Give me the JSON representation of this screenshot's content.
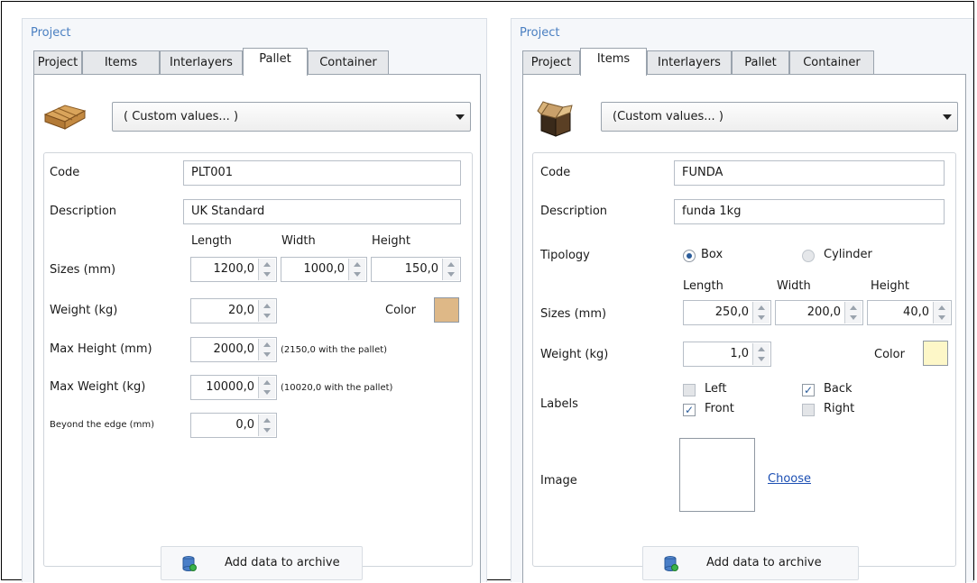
{
  "left_panel": {
    "title": "Project",
    "tabs": [
      "Project",
      "Items",
      "Interlayers",
      "Pallet",
      "Container"
    ],
    "active_tab": "Pallet",
    "icon": "pallet-icon",
    "preset": "( Custom values... )",
    "fields": {
      "code_label": "Code",
      "code": "PLT001",
      "description_label": "Description",
      "description": "UK Standard",
      "length_header": "Length",
      "width_header": "Width",
      "height_header": "Height",
      "sizes_label": "Sizes (mm)",
      "length": "1200,0",
      "width": "1000,0",
      "height": "150,0",
      "weight_label": "Weight (kg)",
      "weight": "20,0",
      "color_label": "Color",
      "color": "#deb887",
      "max_height_label": "Max Height (mm)",
      "max_height": "2000,0",
      "max_height_note": "(2150,0 with the pallet)",
      "max_weight_label": "Max Weight (kg)",
      "max_weight": "10000,0",
      "max_weight_note": "(10020,0 with the pallet)",
      "edge_label": "Beyond the edge (mm)",
      "edge": "0,0"
    },
    "add_button": "Add data to archive"
  },
  "right_panel": {
    "title": "Project",
    "tabs": [
      "Project",
      "Items",
      "Interlayers",
      "Pallet",
      "Container"
    ],
    "active_tab": "Items",
    "icon": "box-icon",
    "preset": "(Custom values... )",
    "fields": {
      "code_label": "Code",
      "code": "FUNDA",
      "description_label": "Description",
      "description": "funda 1kg",
      "tipology_label": "Tipology",
      "box_label": "Box",
      "cylinder_label": "Cylinder",
      "tipology_selected": "Box",
      "length_header": "Length",
      "width_header": "Width",
      "height_header": "Height",
      "sizes_label": "Sizes (mm)",
      "length": "250,0",
      "width": "200,0",
      "height": "40,0",
      "weight_label": "Weight (kg)",
      "weight": "1,0",
      "color_label": "Color",
      "color": "#fdf7c8",
      "labels_label": "Labels",
      "left_label": "Left",
      "back_label": "Back",
      "front_label": "Front",
      "right_label": "Right",
      "left_checked": false,
      "back_checked": true,
      "front_checked": true,
      "right_checked": false,
      "image_label": "Image",
      "choose_link": "Choose"
    },
    "add_button": "Add data to archive"
  }
}
